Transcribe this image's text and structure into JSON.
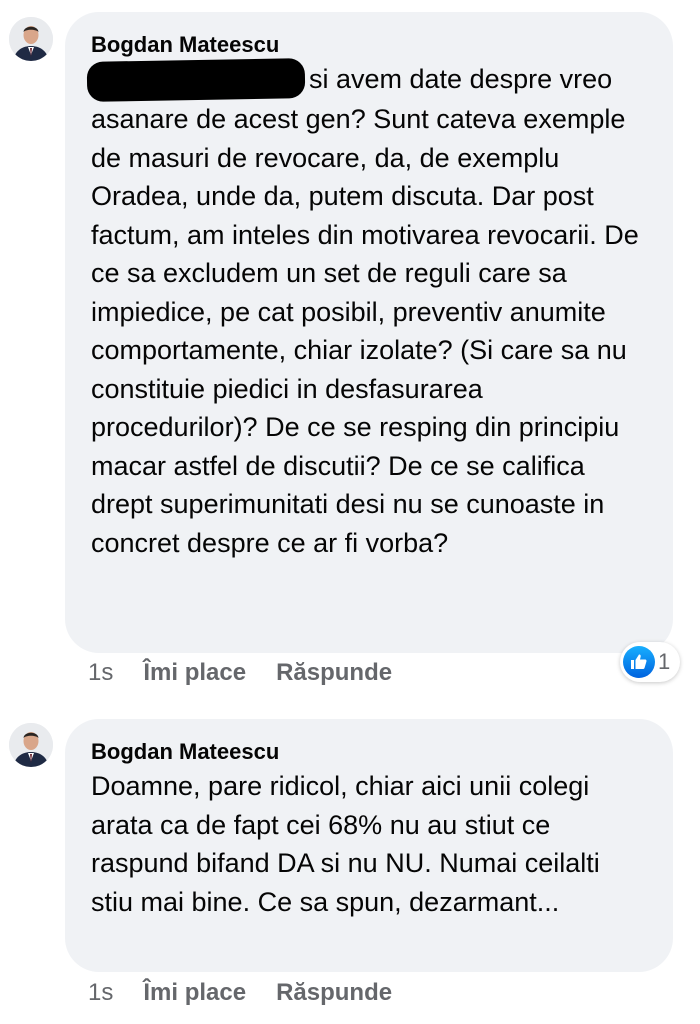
{
  "comments": [
    {
      "author": "Bogdan Mateescu",
      "text": "si avem date despre vreo asanare de acest gen? Sunt cateva exemple de masuri de revocare, da, de exemplu Oradea, unde da, putem discuta. Dar post factum, am inteles din motivarea revocarii. De ce sa excludem un set de reguli care sa impiedice, pe cat posibil, preventiv anumite comportamente, chiar izolate? (Si care sa nu constituie piedici in desfasurarea procedurilor)? De ce se resping din principiu macar astfel de discutii? De ce se califica drept superimunitati desi nu se cunoaste in concret despre ce ar fi vorba?",
      "time": "1s",
      "like_label": "Îmi place",
      "reply_label": "Răspunde",
      "reaction": {
        "icon": "like-icon",
        "count": "1",
        "color": "#1877F2"
      }
    },
    {
      "author": "Bogdan Mateescu",
      "text": "Doamne, pare ridicol, chiar aici unii colegi arata ca de fapt cei 68% nu au stiut ce raspund bifand DA si nu NU. Numai ceilalti stiu mai bine. Ce sa spun, dezarmant...",
      "time": "1s",
      "like_label": "Îmi place",
      "reply_label": "Răspunde"
    }
  ],
  "colors": {
    "bubble": "#F0F2F5",
    "secondary_text": "#65676B",
    "primary_text": "#050505"
  }
}
